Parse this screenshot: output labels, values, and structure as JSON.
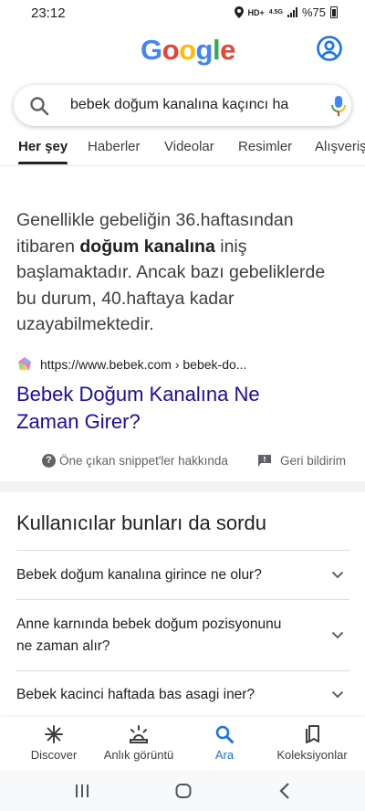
{
  "status": {
    "time": "23:12",
    "network": "HD+",
    "network_sub": "4.5G",
    "battery": "%75"
  },
  "header": {
    "logo_letters": [
      {
        "char": "G",
        "color": "#4285f4"
      },
      {
        "char": "o",
        "color": "#ea4335"
      },
      {
        "char": "o",
        "color": "#fbbc05"
      },
      {
        "char": "g",
        "color": "#4285f4"
      },
      {
        "char": "l",
        "color": "#34a853"
      },
      {
        "char": "e",
        "color": "#ea4335"
      }
    ],
    "account_icon": "account-circle-icon"
  },
  "search": {
    "query": "bebek doğum kanalına kaçıncı ha",
    "icon": "search-icon",
    "mic_icon": "mic-icon"
  },
  "tabs": [
    {
      "label": "Her şey",
      "active": true
    },
    {
      "label": "Haberler"
    },
    {
      "label": "Videolar"
    },
    {
      "label": "Resimler"
    },
    {
      "label": "Alışveriş"
    }
  ],
  "snippet": {
    "text_before": "Genellikle gebeliğin 36.haftasından itibaren ",
    "text_bold": "doğum kanalına",
    "text_after": " iniş başlamaktadır. Ancak bazı gebeliklerde bu durum, 40.haftaya kadar uzayabilmektedir.",
    "source_url": "https://www.bebek.com › bebek-do...",
    "title": "Bebek Doğum Kanalına Ne Zaman Girer?",
    "about_label": "Öne çıkan snippet'ler hakkında",
    "feedback_label": "Geri bildirim"
  },
  "paa": {
    "title": "Kullanıcılar bunları da sordu",
    "questions": [
      "Bebek doğum kanalına girince ne olur?",
      "Anne karnında bebek doğum pozisyonunu ne zaman alır?",
      "Bebek kacinci haftada bas asagi iner?"
    ]
  },
  "bottom_nav": [
    {
      "label": "Discover",
      "icon": "discover-asterisk-icon"
    },
    {
      "label": "Anlık görüntü",
      "icon": "snapshot-icon"
    },
    {
      "label": "Ara",
      "icon": "search-icon",
      "active": true
    },
    {
      "label": "Koleksiyonlar",
      "icon": "collections-icon"
    }
  ],
  "colors": {
    "link": "#1a0dab",
    "accent": "#1a73e8"
  }
}
